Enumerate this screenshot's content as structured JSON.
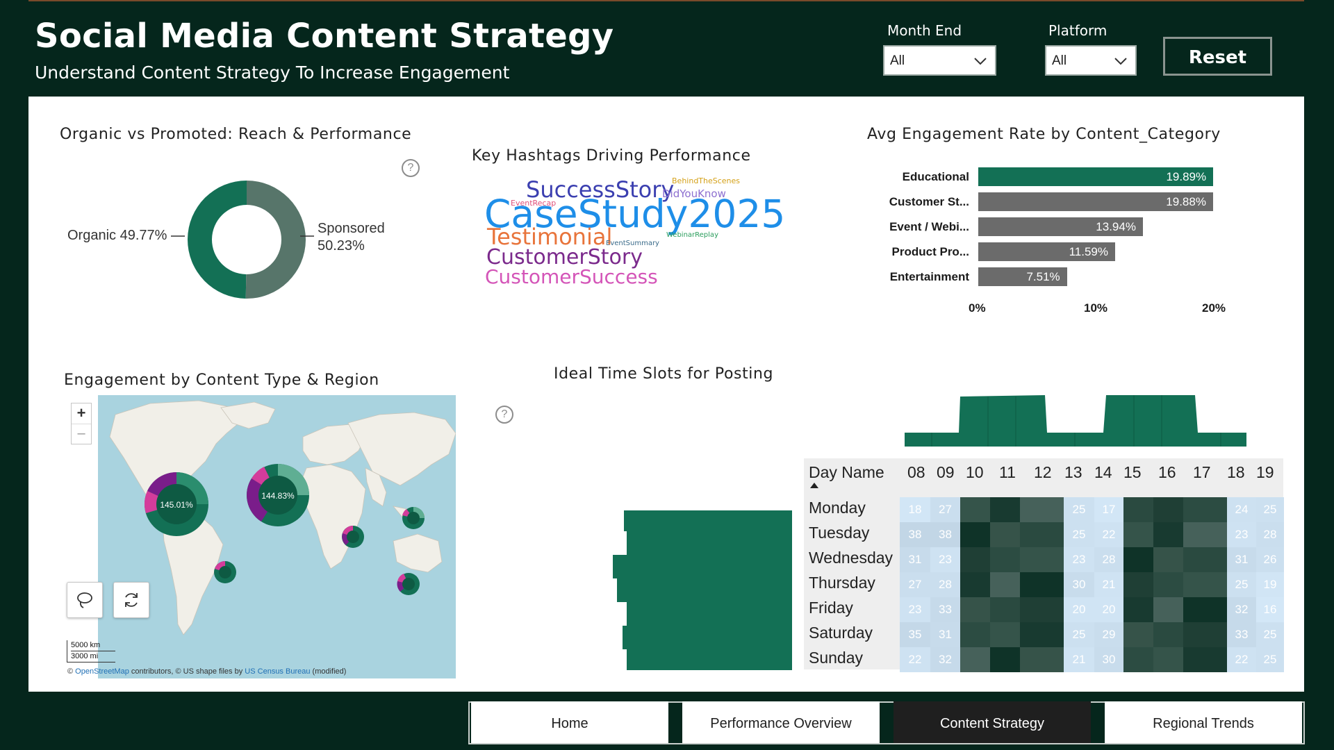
{
  "header": {
    "title": "Social Media Content Strategy",
    "subtitle": "Understand Content Strategy To Increase Engagement"
  },
  "filters": {
    "month_end": {
      "label": "Month End",
      "value": "All"
    },
    "platform": {
      "label": "Platform",
      "value": "All"
    },
    "reset_label": "Reset"
  },
  "donut": {
    "title": "Organic vs Promoted: Reach & Performance",
    "organic": {
      "label": "Organic 49.77%",
      "value": 49.77,
      "color": "#137055"
    },
    "sponsored": {
      "label_line1": "Sponsored",
      "label_line2": "50.23%",
      "value": 50.23,
      "color": "#57756a"
    },
    "help_glyph": "?"
  },
  "hashtags": {
    "title": "Key Hashtags Driving Performance",
    "words": [
      {
        "text": "SuccessStory",
        "color": "#3b3fb0"
      },
      {
        "text": "BehindTheScenes",
        "color": "#d4a017"
      },
      {
        "text": "DidYouKnow",
        "color": "#8d6fd0"
      },
      {
        "text": "EventRecap",
        "color": "#e0507a"
      },
      {
        "text": "CaseStudy2025",
        "color": "#1e8ee8"
      },
      {
        "text": "Testimonial",
        "color": "#e8743b"
      },
      {
        "text": "EventSummary",
        "color": "#3a6b8a"
      },
      {
        "text": "WebinarReplay",
        "color": "#2a9d5c"
      },
      {
        "text": "CustomerStory",
        "color": "#7b2a8c"
      },
      {
        "text": "CustomerSuccess",
        "color": "#d455b8"
      }
    ]
  },
  "engagement_bar": {
    "title": "Avg Engagement Rate by Content_Category",
    "categories": [
      {
        "label": "Educational",
        "value": 19.89,
        "text": "19.89%",
        "color": "#137055"
      },
      {
        "label": "Customer St...",
        "value": 19.88,
        "text": "19.88%",
        "color": "#6b6b6b"
      },
      {
        "label": "Event / Webi...",
        "value": 13.94,
        "text": "13.94%",
        "color": "#6b6b6b"
      },
      {
        "label": "Product Pro...",
        "value": 11.59,
        "text": "11.59%",
        "color": "#6b6b6b"
      },
      {
        "label": "Entertainment",
        "value": 7.51,
        "text": "7.51%",
        "color": "#6b6b6b"
      }
    ],
    "ticks": [
      "0%",
      "10%",
      "20%"
    ]
  },
  "map": {
    "title": "Engagement by Content Type & Region",
    "zoom_in": "+",
    "zoom_out": "–",
    "bubbles": [
      {
        "label": "145.01%"
      },
      {
        "label": "144.83%"
      }
    ],
    "scale_km": "5000 km",
    "scale_mi": "3000 mi",
    "attribution_prefix": "© ",
    "attribution_osm": "OpenStreetMap",
    "attribution_mid": " contributors, © US shape files by ",
    "attribution_census": "US Census Bureau",
    "attribution_suffix": " (modified)",
    "help_glyph": "?"
  },
  "heatmap": {
    "title": "Ideal Time Slots for Posting",
    "day_header": "Day Name",
    "hours": [
      "08",
      "09",
      "10",
      "11",
      "12",
      "13",
      "14",
      "15",
      "16",
      "17",
      "18",
      "19"
    ],
    "days": [
      "Monday",
      "Tuesday",
      "Wednesday",
      "Thursday",
      "Friday",
      "Saturday",
      "Sunday"
    ],
    "values": [
      [
        "18",
        "27",
        "",
        "",
        "",
        "25",
        "17",
        "",
        "",
        "",
        "24",
        "25"
      ],
      [
        "38",
        "38",
        "",
        "",
        "",
        "25",
        "22",
        "",
        "",
        "",
        "23",
        "28"
      ],
      [
        "31",
        "23",
        "",
        "",
        "",
        "23",
        "28",
        "",
        "",
        "",
        "31",
        "26"
      ],
      [
        "27",
        "28",
        "",
        "",
        "",
        "30",
        "21",
        "",
        "",
        "",
        "25",
        "19"
      ],
      [
        "23",
        "33",
        "",
        "",
        "",
        "20",
        "20",
        "",
        "",
        "",
        "32",
        "16"
      ],
      [
        "35",
        "31",
        "",
        "",
        "",
        "25",
        "29",
        "",
        "",
        "",
        "33",
        "25"
      ],
      [
        "22",
        "32",
        "",
        "",
        "",
        "21",
        "30",
        "",
        "",
        "",
        "22",
        "25"
      ]
    ]
  },
  "nav": {
    "home": "Home",
    "performance": "Performance Overview",
    "content": "Content Strategy",
    "regional": "Regional Trends"
  }
}
